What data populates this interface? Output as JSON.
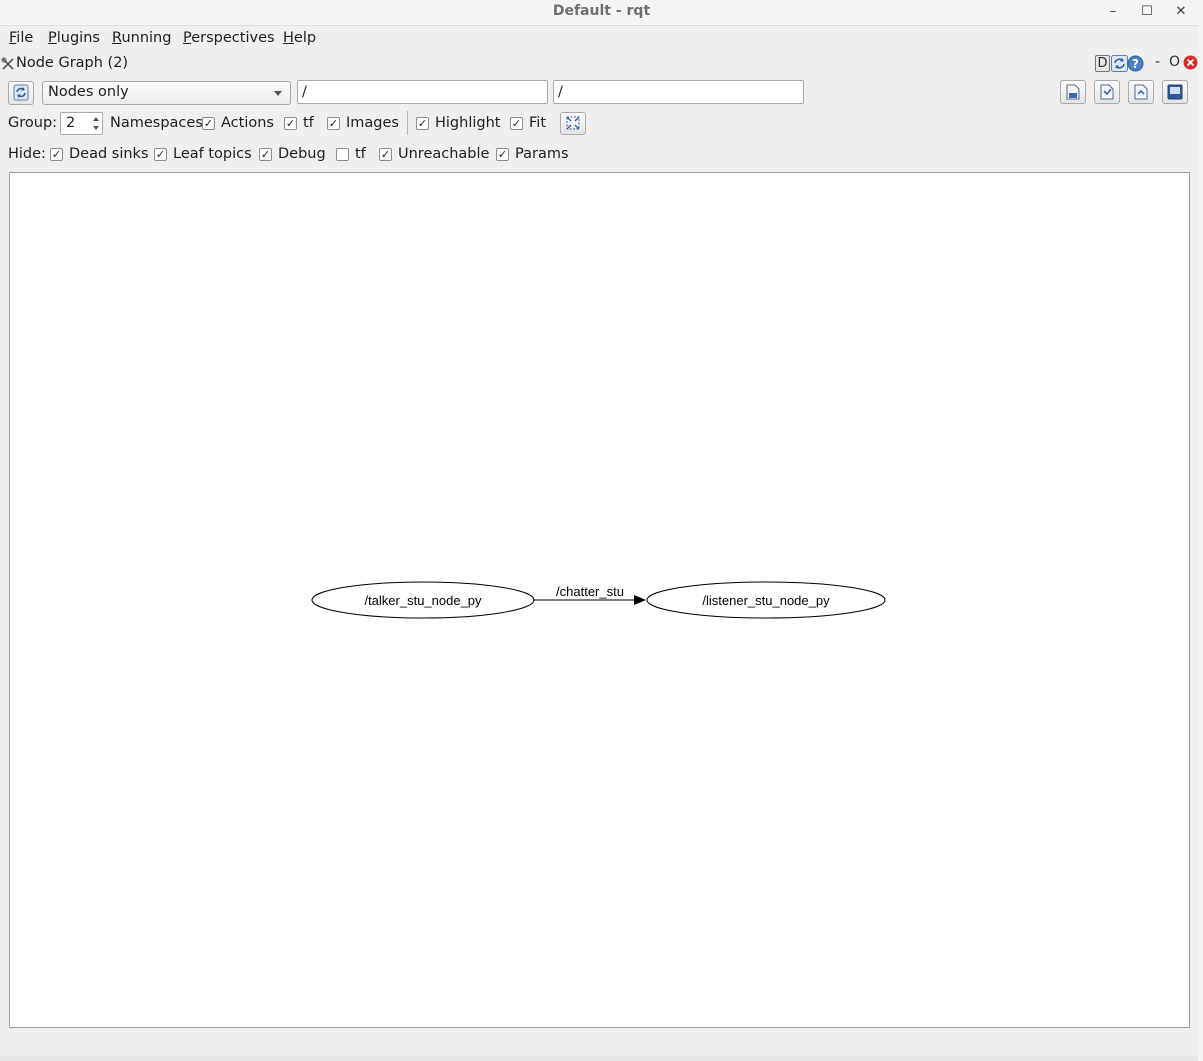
{
  "window": {
    "title": "Default - rqt",
    "minimize_icon": "minimize-icon",
    "maximize_icon": "maximize-icon",
    "close_icon": "close-icon"
  },
  "menubar": {
    "items": [
      {
        "accel": "F",
        "rest": "ile"
      },
      {
        "accel": "P",
        "rest": "lugins"
      },
      {
        "accel": "R",
        "rest": "unning"
      },
      {
        "accel": "P",
        "rest": "erspectives"
      },
      {
        "accel": "H",
        "rest": "elp"
      }
    ]
  },
  "plugin": {
    "title": "Node Graph (2)",
    "dock_labels": {
      "d": "D",
      "dash": "-",
      "o": "O"
    }
  },
  "toolbar": {
    "graph_type": "Nodes only",
    "node_filter": "/",
    "topic_filter": "/"
  },
  "group_row": {
    "group_label": "Group:",
    "group_value": "2",
    "namespaces_label": "Namespaces",
    "options": [
      {
        "label": "Actions",
        "checked": true
      },
      {
        "label": "tf",
        "checked": true
      },
      {
        "label": "Images",
        "checked": true
      },
      {
        "label": "Highlight",
        "checked": true
      },
      {
        "label": "Fit",
        "checked": true
      }
    ]
  },
  "hide_row": {
    "label": "Hide:",
    "options": [
      {
        "label": "Dead sinks",
        "checked": true
      },
      {
        "label": "Leaf topics",
        "checked": true
      },
      {
        "label": "Debug",
        "checked": true
      },
      {
        "label": "tf",
        "checked": false
      },
      {
        "label": "Unreachable",
        "checked": true
      },
      {
        "label": "Params",
        "checked": true
      }
    ]
  },
  "graph": {
    "nodes": [
      {
        "label": "/talker_stu_node_py"
      },
      {
        "label": "/listener_stu_node_py"
      }
    ],
    "edge": {
      "label": "/chatter_stu",
      "from": "/talker_stu_node_py",
      "to": "/listener_stu_node_py"
    }
  },
  "check_glyph": "✓"
}
